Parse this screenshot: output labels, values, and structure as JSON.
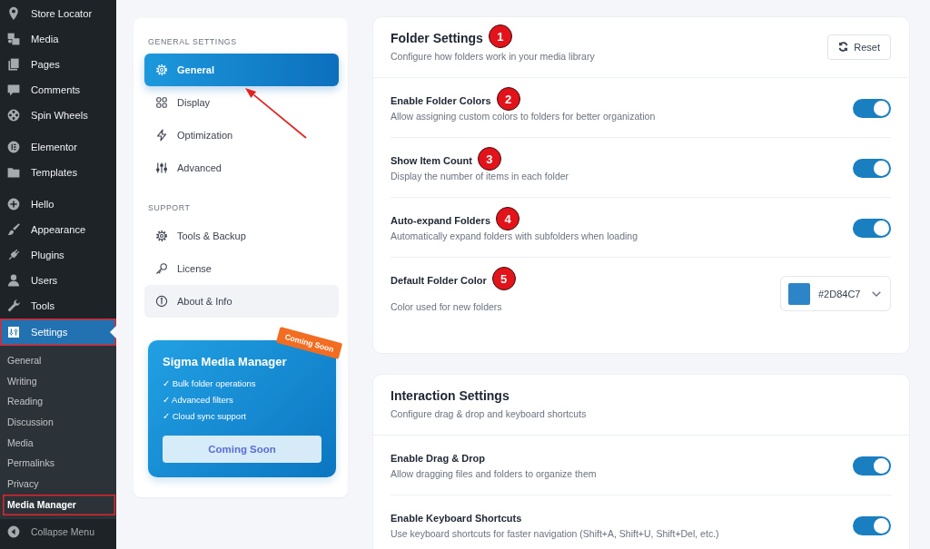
{
  "admin_menu": {
    "groups": [
      {
        "items": [
          {
            "label": "Store Locator",
            "selected": false,
            "outlined": false
          },
          {
            "label": "Media",
            "selected": false,
            "outlined": false
          },
          {
            "label": "Pages",
            "selected": false,
            "outlined": false
          },
          {
            "label": "Comments",
            "selected": false,
            "outlined": false
          },
          {
            "label": "Spin Wheels",
            "selected": false,
            "outlined": false
          }
        ]
      },
      {
        "items": [
          {
            "label": "Elementor",
            "selected": false,
            "outlined": false
          },
          {
            "label": "Templates",
            "selected": false,
            "outlined": false
          }
        ]
      },
      {
        "items": [
          {
            "label": "Hello",
            "selected": false,
            "outlined": false
          },
          {
            "label": "Appearance",
            "selected": false,
            "outlined": false
          },
          {
            "label": "Plugins",
            "selected": false,
            "outlined": false
          },
          {
            "label": "Users",
            "selected": false,
            "outlined": false
          },
          {
            "label": "Tools",
            "selected": false,
            "outlined": false
          },
          {
            "label": "Settings",
            "selected": true,
            "outlined": true,
            "submenu": [
              {
                "label": "General",
                "selected": false,
                "outlined": false
              },
              {
                "label": "Writing",
                "selected": false,
                "outlined": false
              },
              {
                "label": "Reading",
                "selected": false,
                "outlined": false
              },
              {
                "label": "Discussion",
                "selected": false,
                "outlined": false
              },
              {
                "label": "Media",
                "selected": false,
                "outlined": false
              },
              {
                "label": "Permalinks",
                "selected": false,
                "outlined": false
              },
              {
                "label": "Privacy",
                "selected": false,
                "outlined": false
              },
              {
                "label": "Media Manager",
                "selected": true,
                "outlined": true
              }
            ]
          }
        ]
      }
    ],
    "collapse_button": "Collapse Menu"
  },
  "settings_nav": {
    "sections": [
      {
        "heading": "GENERAL SETTINGS",
        "items": [
          {
            "label": "General",
            "selected": true,
            "hovered": false
          },
          {
            "label": "Display",
            "selected": false,
            "hovered": false
          },
          {
            "label": "Optimization",
            "selected": false,
            "hovered": false
          },
          {
            "label": "Advanced",
            "selected": false,
            "hovered": false
          }
        ]
      },
      {
        "heading": "SUPPORT",
        "items": [
          {
            "label": "Tools & Backup",
            "selected": false,
            "hovered": false
          },
          {
            "label": "License",
            "selected": false,
            "hovered": false
          },
          {
            "label": "About & Info",
            "selected": false,
            "hovered": true
          }
        ]
      }
    ]
  },
  "promo_card": {
    "badge": "Coming Soon",
    "title": "Sigma Media Manager",
    "features": [
      "✓ Bulk folder operations",
      "✓ Advanced filters",
      "✓ Cloud sync support"
    ],
    "button": "Coming Soon"
  },
  "panels": [
    {
      "title": "Folder Settings",
      "marker": "1",
      "description": "Configure how folders work in your media library",
      "reset_button": "Reset",
      "settings": [
        {
          "kind": "toggle",
          "label": "Enable Folder Colors",
          "marker": "2",
          "description": "Allow assigning custom colors to folders for better organization",
          "on": true
        },
        {
          "kind": "toggle",
          "label": "Show Item Count",
          "marker": "3",
          "description": "Display the number of items in each folder",
          "on": true
        },
        {
          "kind": "toggle",
          "label": "Auto-expand Folders",
          "marker": "4",
          "description": "Automatically expand folders with subfolders when loading",
          "on": true
        },
        {
          "kind": "color",
          "label": "Default Folder Color",
          "marker": "5",
          "description": "Color used for new folders",
          "value": "#2D84C7",
          "color": "#2d84c7"
        }
      ]
    },
    {
      "title": "Interaction Settings",
      "description": "Configure drag & drop and keyboard shortcuts",
      "settings": [
        {
          "kind": "toggle",
          "label": "Enable Drag & Drop",
          "description": "Allow dragging files and folders to organize them",
          "on": true
        },
        {
          "kind": "toggle",
          "label": "Enable Keyboard Shortcuts",
          "description": "Use keyboard shortcuts for faster navigation (Shift+A, Shift+U, Shift+Del, etc.)",
          "on": true
        }
      ]
    }
  ]
}
